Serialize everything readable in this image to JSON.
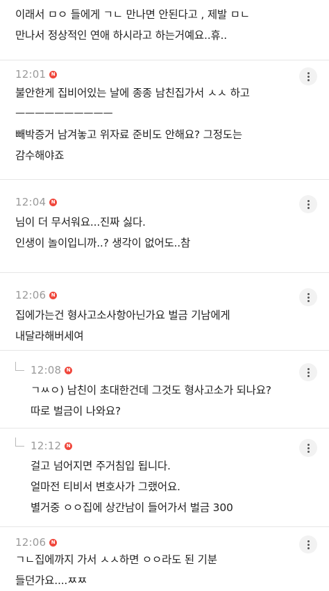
{
  "comments": [
    {
      "time": "",
      "text": "이래서 ㅁㅇ 들에게 ㄱㄴ 만나면 안된다고 , 제발 ㅁㄴ\n만나서 정상적인 연애 하시라고 하는거예요..휴.."
    },
    {
      "time": "12:01",
      "text": "불안한게 집비어있는 날에 종종 남친집가서 ㅅㅅ 하고\nㅡㅡㅡㅡㅡㅡㅡㅡㅡㅡ\n빼박증거 남겨놓고 위자료 준비도 안해요? 그정도는\n감수해야죠"
    },
    {
      "time": "12:04",
      "text": "님이 더 무서워요...진짜 싫다.\n인생이 놀이입니까..? 생각이 없어도..참"
    },
    {
      "time": "12:06",
      "text": "집에가는건 형사고소사항아닌가요 벌금 기남에게\n내달라해버세여"
    },
    {
      "time": "12:08",
      "text": "ㄱㅆㅇ) 남친이 초대한건데 그것도 형사고소가 되나요?\n따로 벌금이 나와요?"
    },
    {
      "time": "12:12",
      "text": "걸고 넘어지면 주거침입 됩니다.\n얼마전 티비서 변호사가 그랬어요.\n별거중 ㅇㅇ집에 상간남이 들어가서 벌금 300"
    },
    {
      "time": "12:06",
      "text": "ㄱㄴ집에까지 가서 ㅅㅅ하면 ㅇㅇ라도 된 기분\n들던가요....ㅉㅉ"
    }
  ],
  "badge_text": "N",
  "colors": {
    "badge": "#f0473c",
    "time": "#9a9a9a",
    "text": "#222222",
    "divider": "#e6e6e6"
  },
  "icons": {
    "more": "more-vertical-icon",
    "reply": "reply-arrow-icon",
    "new": "new-badge-icon"
  }
}
